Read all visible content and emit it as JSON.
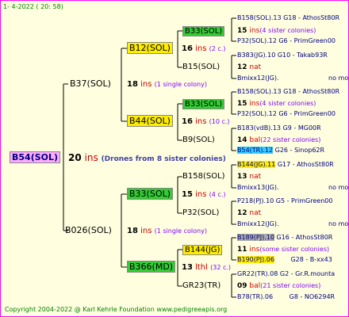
{
  "header": "1-   4-2022 (  20:  58)",
  "footer": "Copyright 2004-2022 @ Karl Kehrle Foundation    www.pedigreeapis.org",
  "root": {
    "name": "B54(SOL)",
    "count": "20",
    "ins": "ins",
    "note": "(Drones from 8 sister colonies)"
  },
  "gen1": [
    {
      "name": "B37(SOL)",
      "count": "18",
      "ins": "ins",
      "note": "(1 single colony)"
    },
    {
      "name": "B026(SOL)",
      "count": "18",
      "ins": "ins",
      "note": "(1 single colony)"
    }
  ],
  "gen2": [
    {
      "name": "B12(SOL)",
      "count": "16",
      "ins": "ins",
      "note": "(2 c.)"
    },
    {
      "name": "B44(SOL)",
      "count": "16",
      "ins": "ins",
      "note": "(10 c.)"
    },
    {
      "name": "B33(SOL)",
      "count": "15",
      "ins": "ins",
      "note": "(4 c.)"
    },
    {
      "name": "B366(MD)",
      "count": "13",
      "ins": "lthl",
      "note": "(32 c.)"
    }
  ],
  "gen3": [
    {
      "name": "B33(SOL)",
      "count": "15",
      "ins": "ins",
      "note": "(4 sister colonies)"
    },
    {
      "name": "B15(SOL)",
      "count": "12",
      "ins": "nat",
      "note": ""
    },
    {
      "name": "B33(SOL)",
      "count": "15",
      "ins": "ins",
      "note": "(4 sister colonies)"
    },
    {
      "name": "B9(SOL)",
      "count": "14",
      "ins": "bal",
      "note": "(22 sister colonies)"
    },
    {
      "name": "B158(SOL)",
      "count": "13",
      "ins": "nat",
      "note": ""
    },
    {
      "name": "P32(SOL)",
      "count": "12",
      "ins": "nat",
      "note": ""
    },
    {
      "name": "B144(JG)",
      "count": "11",
      "ins": "ins",
      "note": "(some sister colonies)"
    },
    {
      "name": "GR23(TR)",
      "count": "09",
      "ins": "bal",
      "note": "(21 sister colonies)"
    }
  ],
  "gen4": [
    {
      "name": "B158(SOL).13",
      "info": "G18 - AthosSt80R"
    },
    {
      "name": "P32(SOL).12",
      "info": "G6 - PrimGreen00"
    },
    {
      "name": "B383(JG).10",
      "info": "G10 - Takab93R"
    },
    {
      "name": "Bmixx12(JG).",
      "info": "no more"
    },
    {
      "name": "B158(SOL).13",
      "info": "G18 - AthosSt80R"
    },
    {
      "name": "P32(SOL).12",
      "info": "G6 - PrimGreen00"
    },
    {
      "name": "B183(vdB).13",
      "info": "G9 - MG00R"
    },
    {
      "name": "B54(TR).12",
      "info": "G26 - Sinop62R"
    },
    {
      "name": "B144(JG).11",
      "info": "G17 - AthosSt80R"
    },
    {
      "name": "Bmixx13(JG).",
      "info": "no more"
    },
    {
      "name": "P218(PJ).10",
      "info": "G5 - PrimGreen00"
    },
    {
      "name": "Bmixx12(JG).",
      "info": "no more"
    },
    {
      "name": "B189(PJ).10",
      "info": "G16 - AthosSt80R"
    },
    {
      "name": "B190(PJ).06",
      "info": "G28 - B-xx43"
    },
    {
      "name": "GR22(TR).08",
      "info": "G2 - Gr.R.mounta"
    },
    {
      "name": "B78(TR).06",
      "info": "G8 - NO6294R"
    }
  ]
}
